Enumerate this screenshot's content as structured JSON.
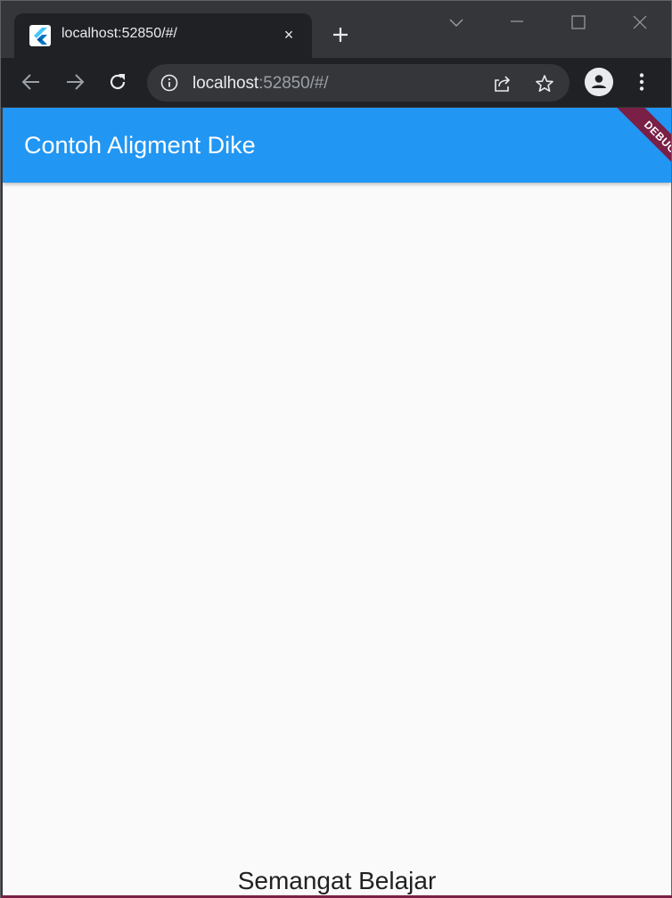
{
  "browser": {
    "tab": {
      "title": "localhost:52850/#/",
      "close_label": "×"
    },
    "address": {
      "host": "localhost",
      "rest": ":52850/#/"
    },
    "icons": {
      "favicon": "flutter-icon",
      "new_tab": "plus-icon",
      "back": "arrow-left-icon",
      "forward": "arrow-right-icon",
      "reload": "reload-icon",
      "info": "info-icon",
      "share": "share-icon",
      "bookmark": "star-icon",
      "profile": "profile-icon",
      "menu": "kebab-menu-icon",
      "tab_search": "chevron-down-icon",
      "minimize": "minimize-icon",
      "maximize": "maximize-icon",
      "close": "close-icon"
    }
  },
  "app": {
    "appbar_title": "Contoh Aligment Dike",
    "debug_banner": "DEBUG",
    "body_text": "Semangat Belajar"
  },
  "colors": {
    "appbar": "#2196f3",
    "debug_banner": "#7a1f45",
    "page_background": "#fafafa",
    "chrome_frame": "#35363a",
    "chrome_toolbar": "#202124"
  }
}
